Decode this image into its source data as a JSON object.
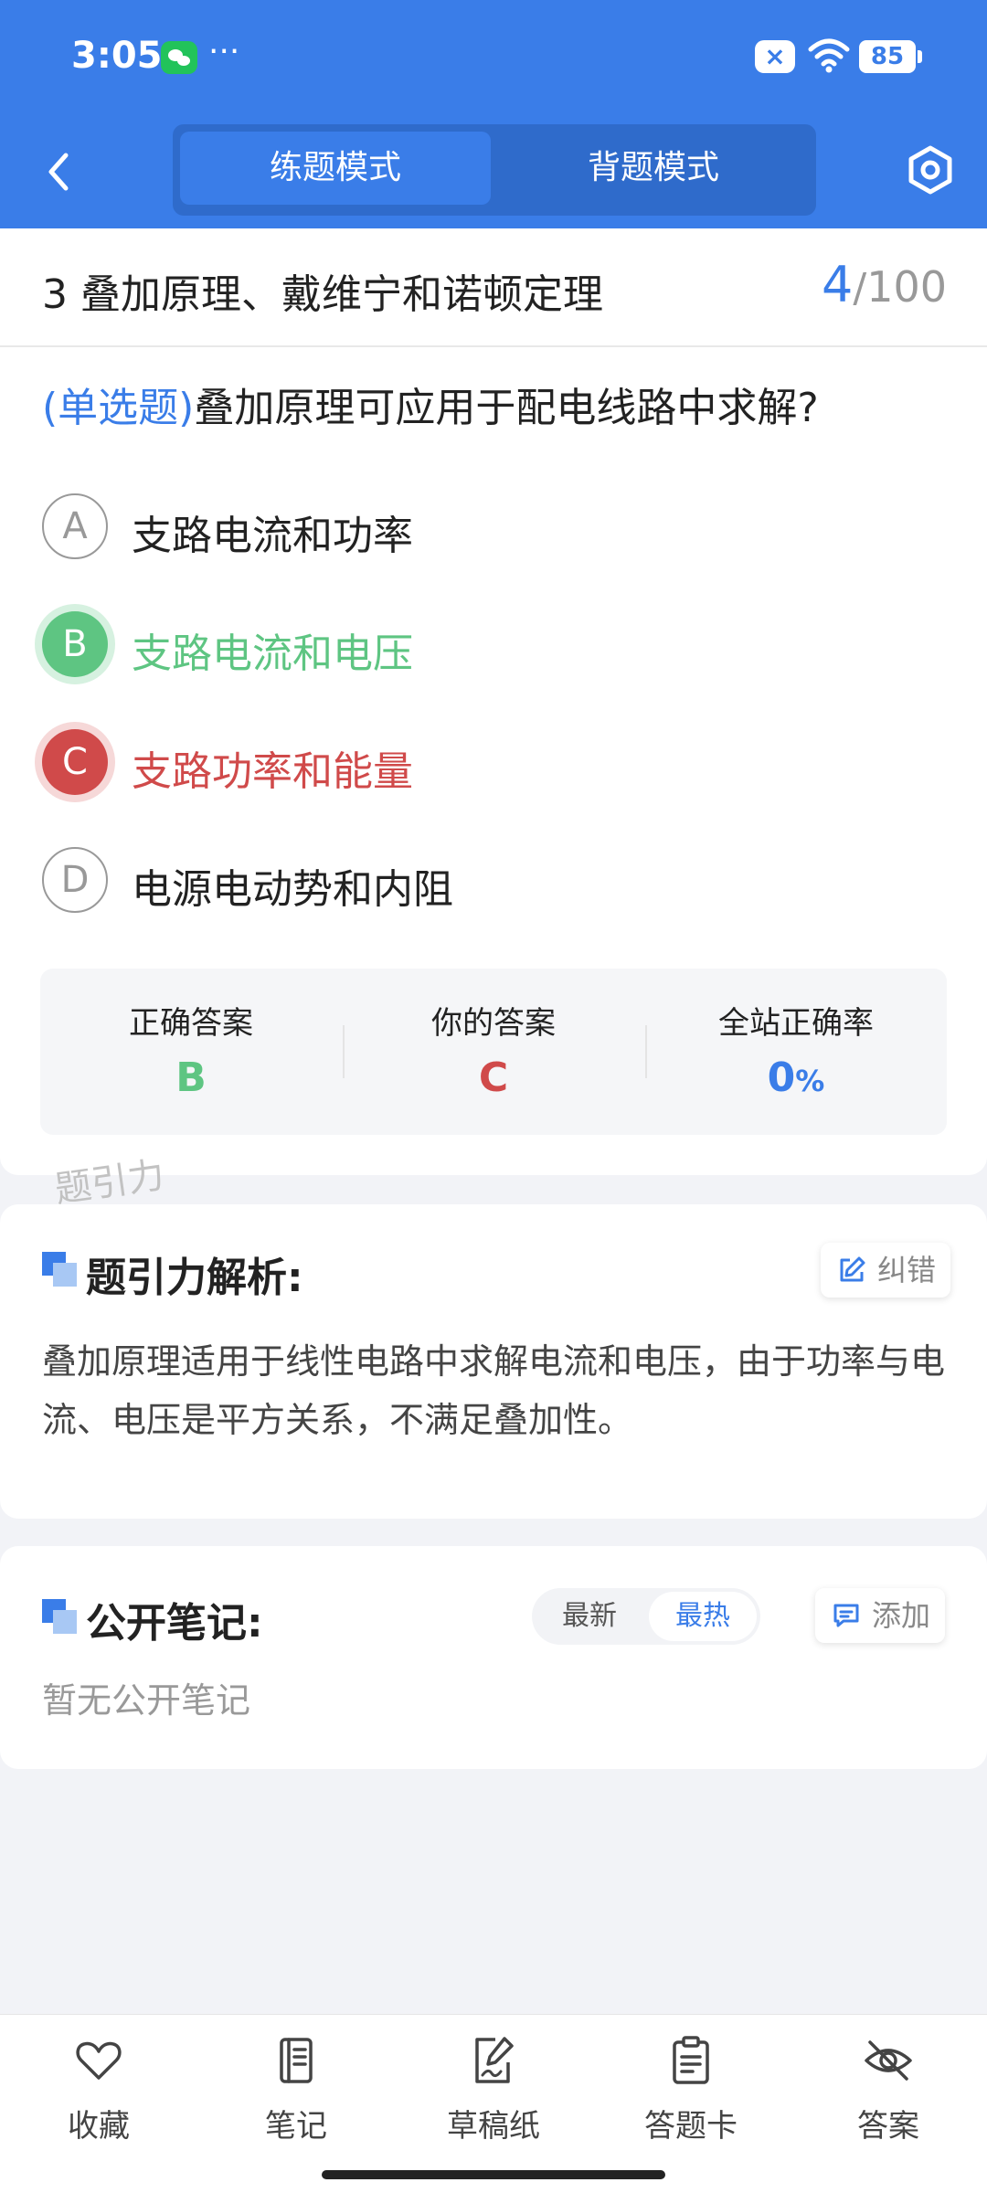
{
  "status_bar": {
    "time": "3:05",
    "more": "···",
    "sim_badge": "×",
    "battery": "85"
  },
  "nav": {
    "tabs": [
      {
        "label": "练题模式",
        "active": true
      },
      {
        "label": "背题模式",
        "active": false
      }
    ]
  },
  "chapter": {
    "title": "3 叠加原理、戴维宁和诺顿定理",
    "current": "4",
    "separator": "/",
    "total": "100"
  },
  "question": {
    "type": "(单选题)",
    "text": "叠加原理可应用于配电线路中求解?"
  },
  "options": [
    {
      "letter": "A",
      "text": "支路电流和功率",
      "state": "normal"
    },
    {
      "letter": "B",
      "text": "支路电流和电压",
      "state": "correct"
    },
    {
      "letter": "C",
      "text": "支路功率和能量",
      "state": "wrong"
    },
    {
      "letter": "D",
      "text": "电源电动势和内阻",
      "state": "normal"
    }
  ],
  "answer_summary": {
    "correct_label": "正确答案",
    "correct_value": "B",
    "yours_label": "你的答案",
    "yours_value": "C",
    "rate_label": "全站正确率",
    "rate_value": "0",
    "rate_unit": "%"
  },
  "watermark": "题引力",
  "analysis": {
    "title": "题引力解析:",
    "correct_button": "纠错",
    "text": "叠加原理适用于线性电路中求解电流和电压，由于功率与电流、电压是平方关系，不满足叠加性。"
  },
  "notes": {
    "title": "公开笔记:",
    "sort_latest": "最新",
    "sort_hot": "最热",
    "add_button": "添加",
    "empty_text": "暂无公开笔记"
  },
  "bottom_tabs": [
    {
      "label": "收藏",
      "icon": "heart-icon"
    },
    {
      "label": "笔记",
      "icon": "notebook-icon"
    },
    {
      "label": "草稿纸",
      "icon": "draft-icon"
    },
    {
      "label": "答题卡",
      "icon": "answer-sheet-icon"
    },
    {
      "label": "答案",
      "icon": "eye-off-icon"
    }
  ],
  "colors": {
    "primary": "#3a7de8",
    "correct": "#5ec582",
    "wrong": "#d04a4a"
  }
}
